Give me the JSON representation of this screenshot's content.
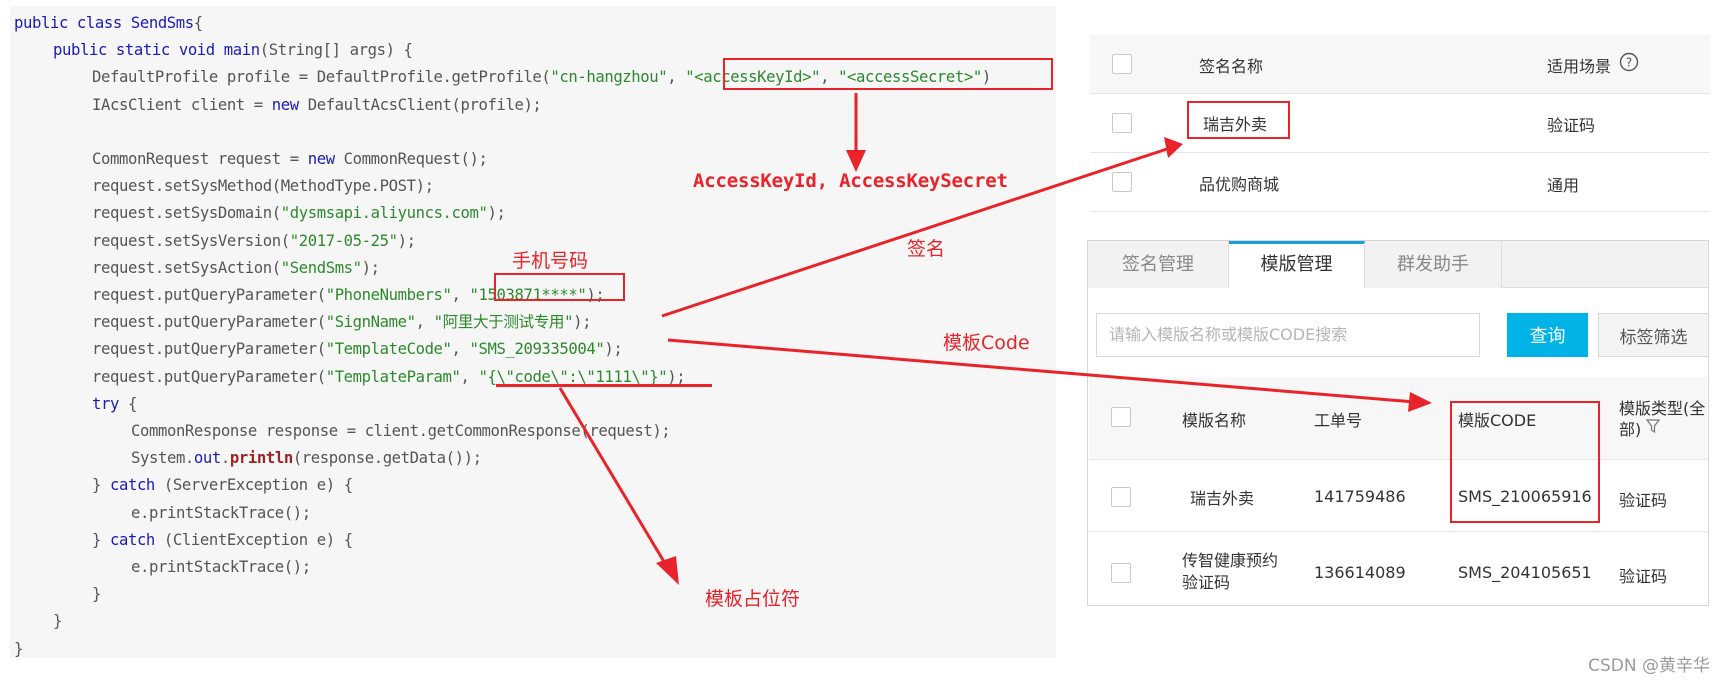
{
  "code_lines": [
    {
      "indent": 0,
      "parts": [
        [
          "kw",
          "public class "
        ],
        [
          "kw",
          "SendSms"
        ],
        [
          "",
          "{"
        ]
      ]
    },
    {
      "indent": 1,
      "parts": [
        [
          "kw",
          "public static void "
        ],
        [
          "kw",
          "main"
        ],
        [
          "",
          "(String[] args) {"
        ]
      ]
    },
    {
      "indent": 2,
      "parts": [
        [
          "",
          "DefaultProfile profile = DefaultProfile.getProfile("
        ],
        [
          "str",
          "\"cn-hangzhou\""
        ],
        [
          "",
          ", "
        ],
        [
          "str",
          "\"<accessKeyId>\""
        ],
        [
          "",
          ", "
        ],
        [
          "str",
          "\"<accessSecret>\""
        ],
        [
          "",
          ")"
        ]
      ]
    },
    {
      "indent": 2,
      "parts": [
        [
          "",
          "IAcsClient client = "
        ],
        [
          "kw",
          "new"
        ],
        [
          "",
          " DefaultAcsClient(profile);"
        ]
      ]
    },
    {
      "indent": 0,
      "parts": [
        [
          "",
          ""
        ]
      ]
    },
    {
      "indent": 2,
      "parts": [
        [
          "",
          "CommonRequest request = "
        ],
        [
          "kw",
          "new"
        ],
        [
          "",
          " CommonRequest();"
        ]
      ]
    },
    {
      "indent": 2,
      "parts": [
        [
          "",
          "request.setSysMethod(MethodType.POST);"
        ]
      ]
    },
    {
      "indent": 2,
      "parts": [
        [
          "",
          "request.setSysDomain("
        ],
        [
          "str",
          "\"dysmsapi.aliyuncs.com\""
        ],
        [
          "",
          ");"
        ]
      ]
    },
    {
      "indent": 2,
      "parts": [
        [
          "",
          "request.setSysVersion("
        ],
        [
          "str",
          "\"2017-05-25\""
        ],
        [
          "",
          ");"
        ]
      ]
    },
    {
      "indent": 2,
      "parts": [
        [
          "",
          "request.setSysAction("
        ],
        [
          "str",
          "\"SendSms\""
        ],
        [
          "",
          ");"
        ]
      ]
    },
    {
      "indent": 2,
      "parts": [
        [
          "",
          "request.putQueryParameter("
        ],
        [
          "str",
          "\"PhoneNumbers\""
        ],
        [
          "",
          ", "
        ],
        [
          "str",
          "\"1503871****\""
        ],
        [
          "",
          ");"
        ]
      ]
    },
    {
      "indent": 2,
      "parts": [
        [
          "",
          "request.putQueryParameter("
        ],
        [
          "str",
          "\"SignName\""
        ],
        [
          "",
          ", "
        ],
        [
          "str",
          "\"阿里大于测试专用\""
        ],
        [
          "",
          ");"
        ]
      ]
    },
    {
      "indent": 2,
      "parts": [
        [
          "",
          "request.putQueryParameter("
        ],
        [
          "str",
          "\"TemplateCode\""
        ],
        [
          "",
          ", "
        ],
        [
          "str",
          "\"SMS_209335004\""
        ],
        [
          "",
          ");"
        ]
      ]
    },
    {
      "indent": 2,
      "parts": [
        [
          "",
          "request.putQueryParameter("
        ],
        [
          "str",
          "\"TemplateParam\""
        ],
        [
          "",
          ", "
        ],
        [
          "str",
          "\"{\\\"code\\\":\\\"1111\\\"}\""
        ],
        [
          "",
          ");"
        ]
      ]
    },
    {
      "indent": 2,
      "parts": [
        [
          "kw",
          "try"
        ],
        [
          "",
          " {"
        ]
      ]
    },
    {
      "indent": 3,
      "parts": [
        [
          "",
          "CommonResponse response = client.getCommonResponse(request);"
        ]
      ]
    },
    {
      "indent": 3,
      "parts": [
        [
          "",
          "System."
        ],
        [
          "kw",
          "out"
        ],
        [
          "",
          "."
        ],
        [
          "mth",
          "println"
        ],
        [
          "",
          "(response.getData());"
        ]
      ]
    },
    {
      "indent": 2,
      "parts": [
        [
          "",
          "} "
        ],
        [
          "kw",
          "catch"
        ],
        [
          "",
          " (ServerException e) {"
        ]
      ]
    },
    {
      "indent": 3,
      "parts": [
        [
          "",
          "e.printStackTrace();"
        ]
      ]
    },
    {
      "indent": 2,
      "parts": [
        [
          "",
          "} "
        ],
        [
          "kw",
          "catch"
        ],
        [
          "",
          " (ClientException e) {"
        ]
      ]
    },
    {
      "indent": 3,
      "parts": [
        [
          "",
          "e.printStackTrace();"
        ]
      ]
    },
    {
      "indent": 2,
      "parts": [
        [
          "",
          "}"
        ]
      ]
    },
    {
      "indent": 1,
      "parts": [
        [
          "",
          "}"
        ]
      ]
    },
    {
      "indent": 0,
      "parts": [
        [
          "",
          "}"
        ]
      ]
    }
  ],
  "annotations": {
    "access_key": "AccessKeyId, AccessKeySecret",
    "phone": "手机号码",
    "sign": "签名",
    "template_code": "模板Code",
    "placeholder": "模板占位符"
  },
  "sign_table": {
    "headers": {
      "name": "签名名称",
      "scene": "适用场景"
    },
    "help_icon": "question-circle",
    "rows": [
      {
        "name": "瑞吉外卖",
        "scene": "验证码"
      },
      {
        "name": "品优购商城",
        "scene": "通用"
      }
    ]
  },
  "template_panel": {
    "tabs": [
      "签名管理",
      "模版管理",
      "群发助手"
    ],
    "active_tab": 1,
    "search_placeholder": "请输入模版名称或模版CODE搜索",
    "query_label": "查询",
    "tag_filter_label": "标签筛选",
    "headers": {
      "name": "模版名称",
      "ticket": "工单号",
      "code": "模版CODE",
      "type_line1": "模版类型(全",
      "type_line2": "部)"
    },
    "filter_icon": "funnel",
    "rows": [
      {
        "name": "瑞吉外卖",
        "name2": "",
        "ticket": "141759486",
        "code": "SMS_210065916",
        "type": "验证码"
      },
      {
        "name": "传智健康预约",
        "name2": "验证码",
        "ticket": "136614089",
        "code": "SMS_204105651",
        "type": "验证码"
      }
    ]
  },
  "watermark": "CSDN @黄辛华",
  "colors": {
    "annotation": "#e8232a",
    "query_button": "#00b3e6",
    "active_tab_border": "#1ba0d7"
  }
}
